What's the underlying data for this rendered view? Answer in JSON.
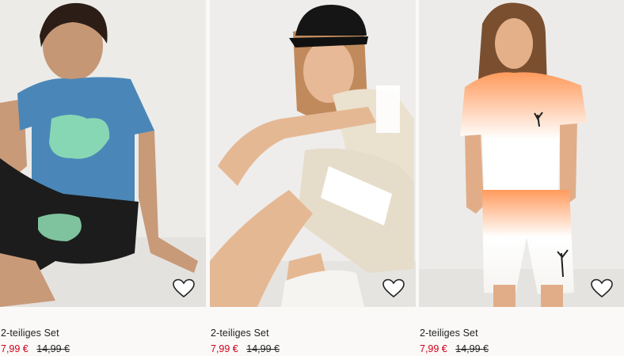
{
  "products": [
    {
      "name": "2-teiliges Set",
      "sale_price": "7,99 €",
      "original_price": "14,99 €",
      "image_desc": "boy-blue-tshirt-black-shorts"
    },
    {
      "name": "2-teiliges Set",
      "sale_price": "7,99 €",
      "original_price": "14,99 €",
      "image_desc": "boy-beige-white-set-black-cap"
    },
    {
      "name": "2-teiliges Set",
      "sale_price": "7,99 €",
      "original_price": "14,99 €",
      "image_desc": "boy-orange-white-dip-dye-set"
    }
  ],
  "colors": {
    "sale": "#d0011b",
    "text": "#222222",
    "background": "#faf9f8"
  },
  "icons": {
    "favorite": "heart-outline-icon"
  }
}
